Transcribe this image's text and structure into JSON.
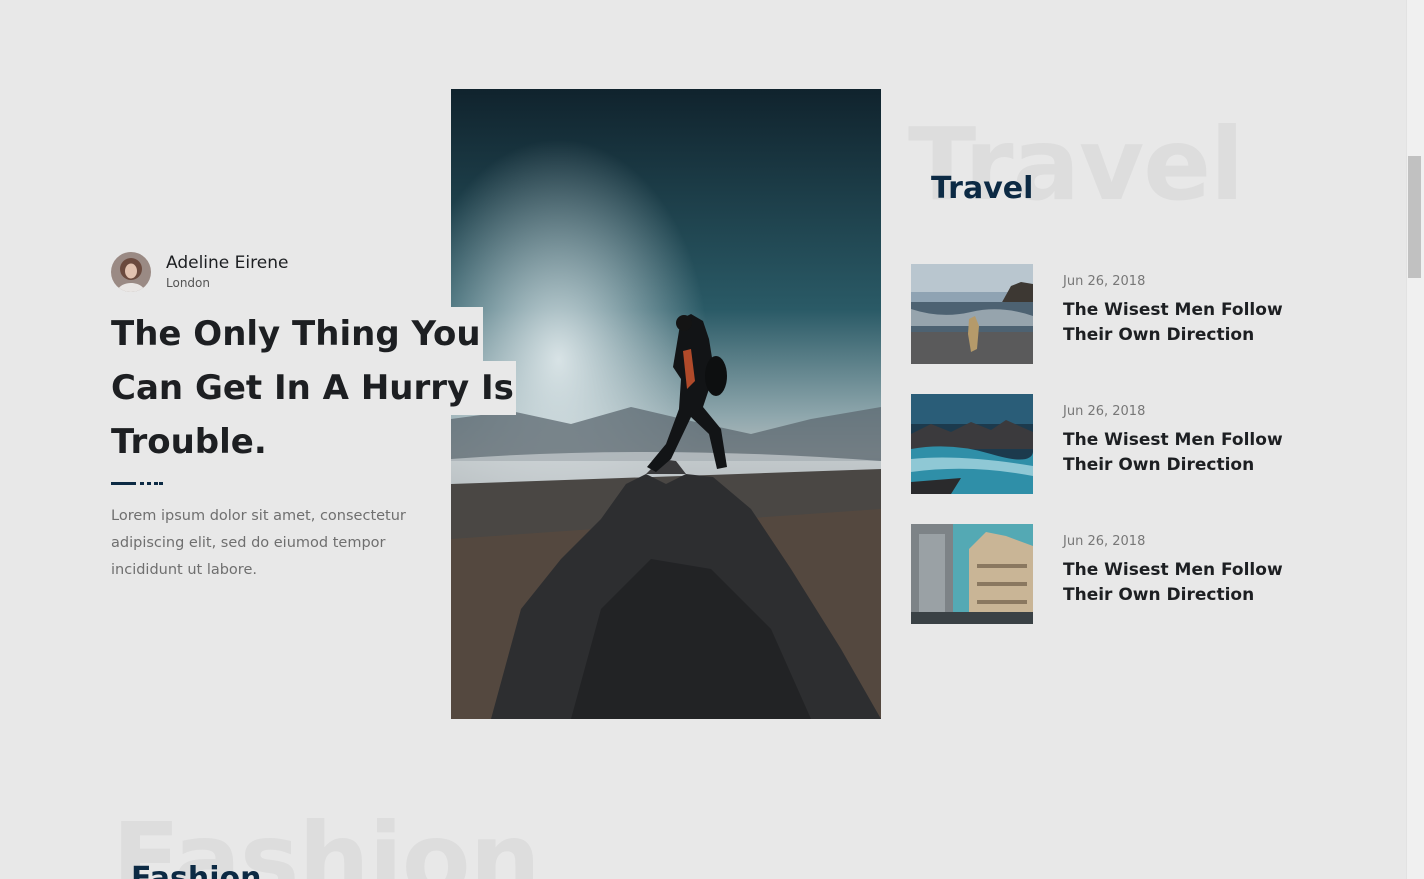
{
  "author": {
    "name": "Adeline Eirene",
    "location": "London"
  },
  "featured": {
    "headline_lines": [
      "The Only Thing You",
      "Can Get In A Hurry Is",
      "Trouble."
    ],
    "excerpt": "Lorem ipsum dolor sit amet, consectetur adipiscing elit, sed do eiumod tempor incididunt ut labore."
  },
  "travel": {
    "ghost": "Travel",
    "title": "Travel",
    "posts": [
      {
        "date": "Jun 26, 2018",
        "title": "The Wisest Men Follow Their Own Direction"
      },
      {
        "date": "Jun 26, 2018",
        "title": "The Wisest Men Follow Their Own Direction"
      },
      {
        "date": "Jun 26, 2018",
        "title": "The Wisest Men Follow Their Own Direction"
      }
    ]
  },
  "fashion": {
    "ghost": "Fashion",
    "title": "Fashion"
  },
  "colors": {
    "background": "#e8e8e8",
    "accent": "#0c2a44",
    "text": "#1d1f22",
    "ghost": "#dddddd"
  }
}
